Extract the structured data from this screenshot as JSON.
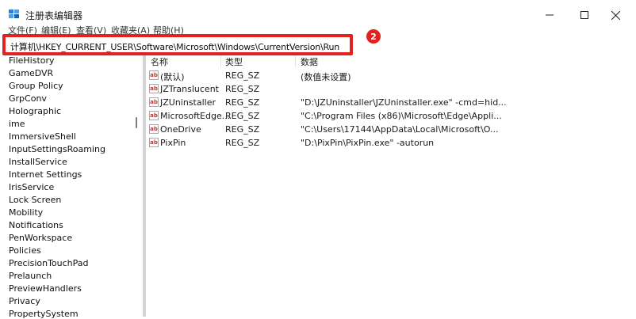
{
  "window": {
    "title": "注册表编辑器"
  },
  "menu": [
    "文件(F)",
    "编辑(E)",
    "查看(V)",
    "收藏夹(A)",
    "帮助(H)"
  ],
  "address": {
    "path": "计算机\\HKEY_CURRENT_USER\\Software\\Microsoft\\Windows\\CurrentVersion\\Run"
  },
  "annotation": {
    "badge": "2",
    "color": "#e3211f"
  },
  "tree": {
    "items": [
      "FileHistory",
      "GameDVR",
      "Group Policy",
      "GrpConv",
      "Holographic",
      "ime",
      "ImmersiveShell",
      "InputSettingsRoaming",
      "InstallService",
      "Internet Settings",
      "IrisService",
      "Lock Screen",
      "Mobility",
      "Notifications",
      "PenWorkspace",
      "Policies",
      "PrecisionTouchPad",
      "Prelaunch",
      "PreviewHandlers",
      "Privacy",
      "PropertySystem"
    ]
  },
  "list": {
    "columns": [
      "名称",
      "类型",
      "数据"
    ],
    "rows": [
      {
        "name": "(默认)",
        "type": "REG_SZ",
        "data": "(数值未设置)"
      },
      {
        "name": "JZTranslucent",
        "type": "REG_SZ",
        "data": ""
      },
      {
        "name": "JZUninstaller",
        "type": "REG_SZ",
        "data": "\"D:\\JZUninstaller\\JZUninstaller.exe\" -cmd=hid..."
      },
      {
        "name": "MicrosoftEdge...",
        "type": "REG_SZ",
        "data": "\"C:\\Program Files (x86)\\Microsoft\\Edge\\Appli..."
      },
      {
        "name": "OneDrive",
        "type": "REG_SZ",
        "data": "\"C:\\Users\\17144\\AppData\\Local\\Microsoft\\O..."
      },
      {
        "name": "PixPin",
        "type": "REG_SZ",
        "data": "\"D:\\PixPin\\PixPin.exe\" -autorun"
      }
    ],
    "icon_label": "ab"
  },
  "icons": [
    "regedit-icon",
    "minimize-icon",
    "maximize-icon",
    "close-icon",
    "string-value-icon"
  ]
}
